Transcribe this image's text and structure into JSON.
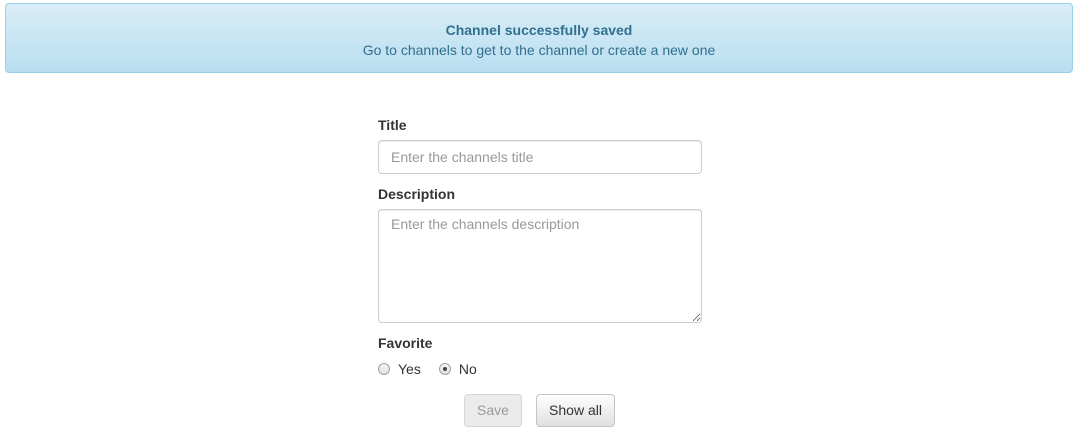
{
  "alert": {
    "title": "Channel successfully saved",
    "message": "Go to channels to get to the channel or create a new one"
  },
  "form": {
    "title_label": "Title",
    "title_placeholder": "Enter the channels title",
    "title_value": "",
    "description_label": "Description",
    "description_placeholder": "Enter the channels description",
    "description_value": "",
    "favorite_label": "Favorite",
    "favorite_options": [
      {
        "label": "Yes",
        "checked": false
      },
      {
        "label": "No",
        "checked": true
      }
    ],
    "save_label": "Save",
    "save_disabled": true,
    "show_all_label": "Show all"
  },
  "colors": {
    "alert_text": "#31708f",
    "alert_border": "#9acfea",
    "alert_bg_top": "#d9edf7",
    "alert_bg_bottom": "#b9def0",
    "input_border": "#cccccc",
    "placeholder": "#999999"
  }
}
